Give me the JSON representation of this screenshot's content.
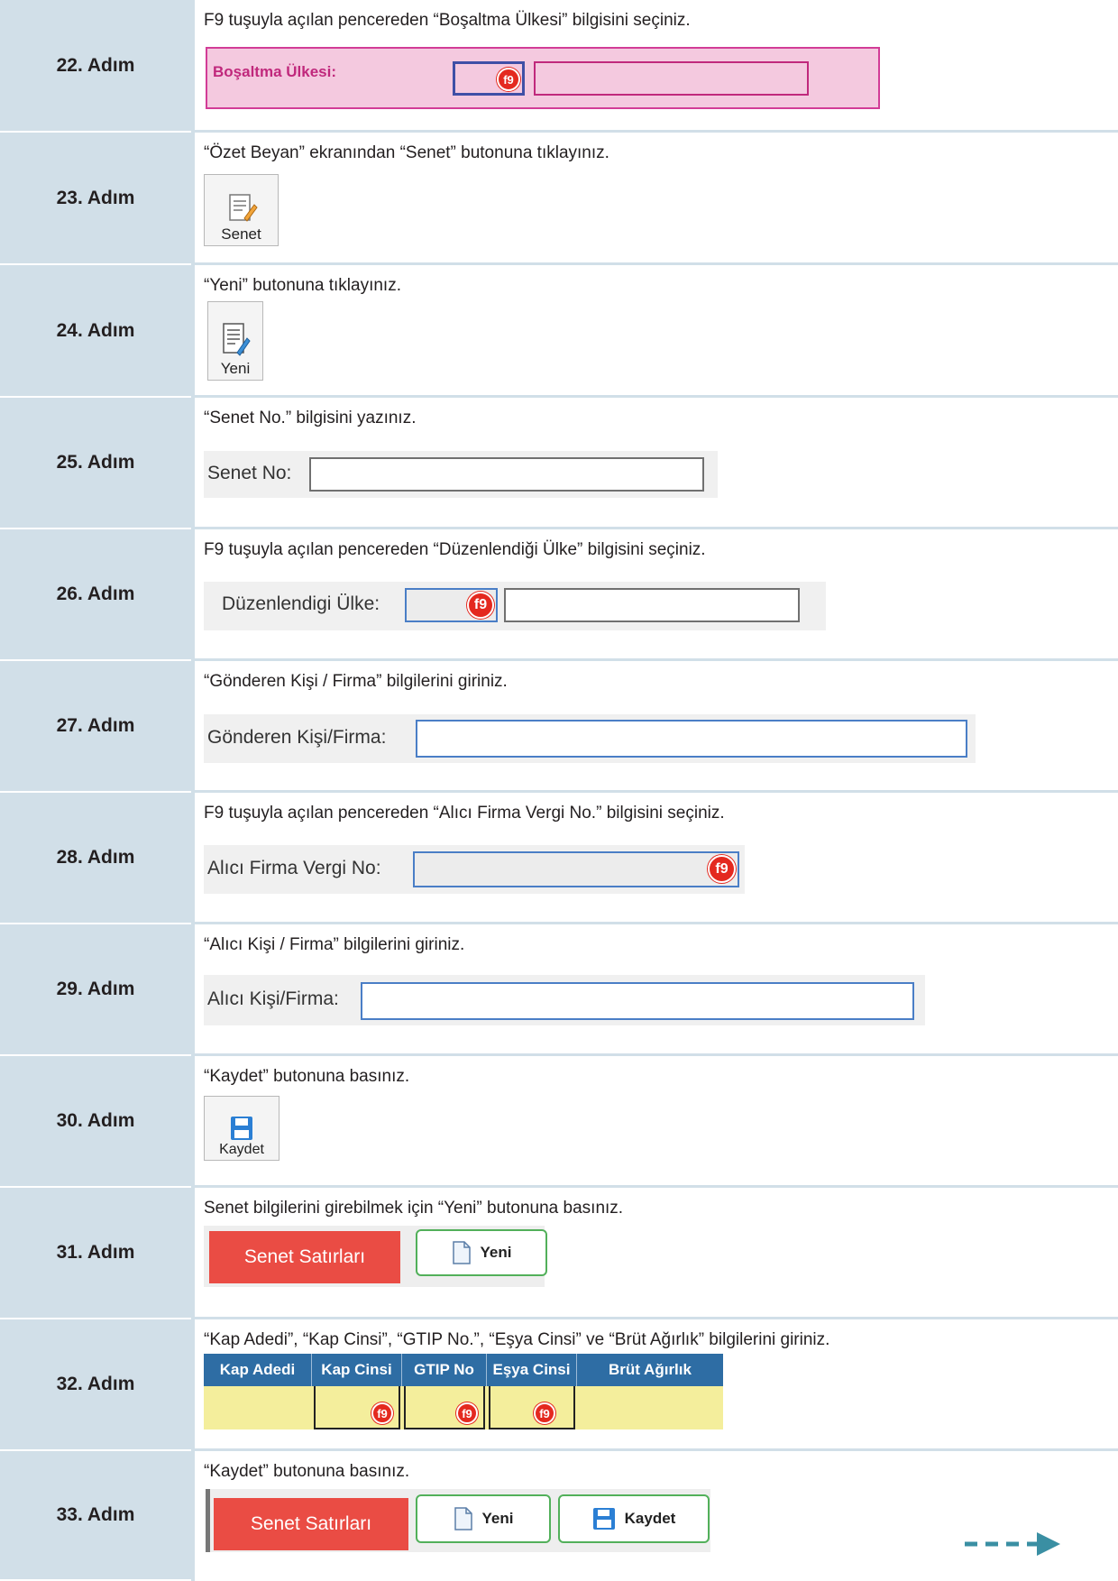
{
  "steps": [
    {
      "label": "22. Adım",
      "instruction": "F9 tuşuyla açılan pencereden “Boşaltma Ülkesi” bilgisini seçiniz.",
      "field_label": "Boşaltma Ülkesi:",
      "f9": "f9"
    },
    {
      "label": "23. Adım",
      "instruction": "“Özet Beyan” ekranından “Senet” butonuna tıklayınız.",
      "button_label": "Senet"
    },
    {
      "label": "24. Adım",
      "instruction": "“Yeni” butonuna tıklayınız.",
      "button_label": "Yeni"
    },
    {
      "label": "25. Adım",
      "instruction": "“Senet No.” bilgisini yazınız.",
      "field_label": "Senet No:"
    },
    {
      "label": "26. Adım",
      "instruction": "F9 tuşuyla açılan pencereden “Düzenlendiği Ülke” bilgisini seçiniz.",
      "field_label": "Düzenlendigi Ülke:",
      "f9": "f9"
    },
    {
      "label": "27. Adım",
      "instruction": "“Gönderen Kişi / Firma” bilgilerini giriniz.",
      "field_label": "Gönderen Kişi/Firma:"
    },
    {
      "label": "28. Adım",
      "instruction": "F9 tuşuyla açılan pencereden “Alıcı Firma Vergi No.” bilgisini seçiniz.",
      "field_label": "Alıcı Firma Vergi No:",
      "f9": "f9"
    },
    {
      "label": "29. Adım",
      "instruction": "“Alıcı Kişi / Firma” bilgilerini giriniz.",
      "field_label": "Alıcı Kişi/Firma:"
    },
    {
      "label": "30. Adım",
      "instruction": "“Kaydet” butonuna basınız.",
      "button_label": "Kaydet"
    },
    {
      "label": "31. Adım",
      "instruction": "Senet bilgilerini girebilmek için “Yeni” butonuna basınız.",
      "tab_label": "Senet Satırları",
      "button_label": "Yeni"
    },
    {
      "label": "32. Adım",
      "instruction": "“Kap Adedi”, “Kap Cinsi”, “GTIP No.”, “Eşya Cinsi” ve “Brüt Ağırlık” bilgilerini giriniz.",
      "columns": [
        "Kap Adedi",
        "Kap Cinsi",
        "GTIP No",
        "Eşya Cinsi",
        "Brüt Ağırlık"
      ],
      "f9": "f9"
    },
    {
      "label": "33. Adım",
      "instruction": "“Kaydet” butonuna basınız.",
      "tab_label": "Senet Satırları",
      "button_label": "Yeni",
      "button2_label": "Kaydet"
    }
  ],
  "colors": {
    "step_bg": "#d1dfe8",
    "f9_red": "#e4291f",
    "tab_red": "#ea4c44",
    "continue_arrow": "#3a8fa3"
  },
  "icons": [
    "document-edit-icon",
    "floppy-disk-icon",
    "document-icon",
    "continue-arrow-icon"
  ]
}
